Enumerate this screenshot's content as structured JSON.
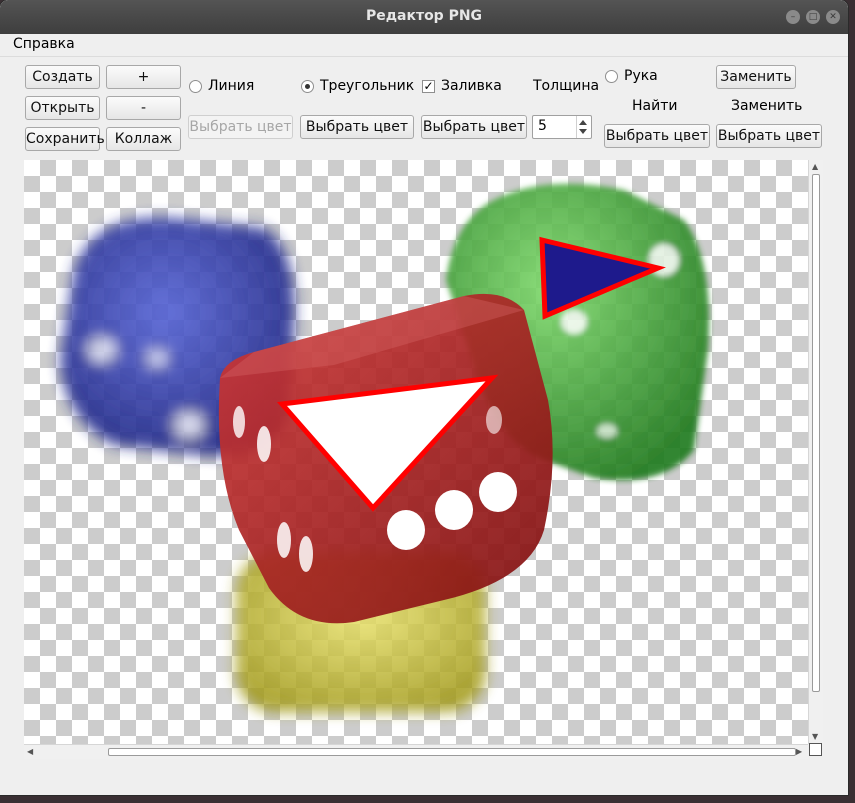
{
  "window": {
    "title": "Редактор PNG"
  },
  "menu": {
    "items": [
      "Справка"
    ]
  },
  "toolbar": {
    "create": "Создать",
    "open": "Открыть",
    "save": "Сохранить",
    "zoom_in": "+",
    "zoom_out": "-",
    "collage": "Коллаж",
    "line": {
      "label": "Линия",
      "checked": false,
      "color_button": "Выбрать цвет",
      "color_button_enabled": false
    },
    "triangle": {
      "label": "Треугольник",
      "checked": true,
      "color_button": "Выбрать цвет"
    },
    "fill": {
      "label": "Заливка",
      "checked": true,
      "color_button": "Выбрать цвет"
    },
    "thickness": {
      "label": "Толщина",
      "value": "5"
    },
    "hand": {
      "label": "Рука",
      "checked": false
    },
    "find": {
      "label": "Найти",
      "color_button": "Выбрать цвет"
    },
    "replace": {
      "button": "Заменить",
      "label": "Заменить",
      "color_button": "Выбрать цвет"
    }
  },
  "canvas": {
    "dice": [
      {
        "name": "blue-die",
        "color": "#2b35a8",
        "pips": 3
      },
      {
        "name": "green-die",
        "color": "#2f9a2b",
        "pips": 3
      },
      {
        "name": "yellow-die",
        "color": "#c8c02a"
      },
      {
        "name": "red-die",
        "color": "#b01a1a",
        "pips": 3
      }
    ],
    "shapes": [
      {
        "name": "triangle-white",
        "outline": "#ff0000",
        "fill": "#ffffff"
      },
      {
        "name": "triangle-navy",
        "outline": "#ff0000",
        "fill": "#1e1a8c"
      }
    ]
  },
  "icons": {
    "minimize": "minimize-icon",
    "maximize": "maximize-icon",
    "close": "close-icon"
  }
}
